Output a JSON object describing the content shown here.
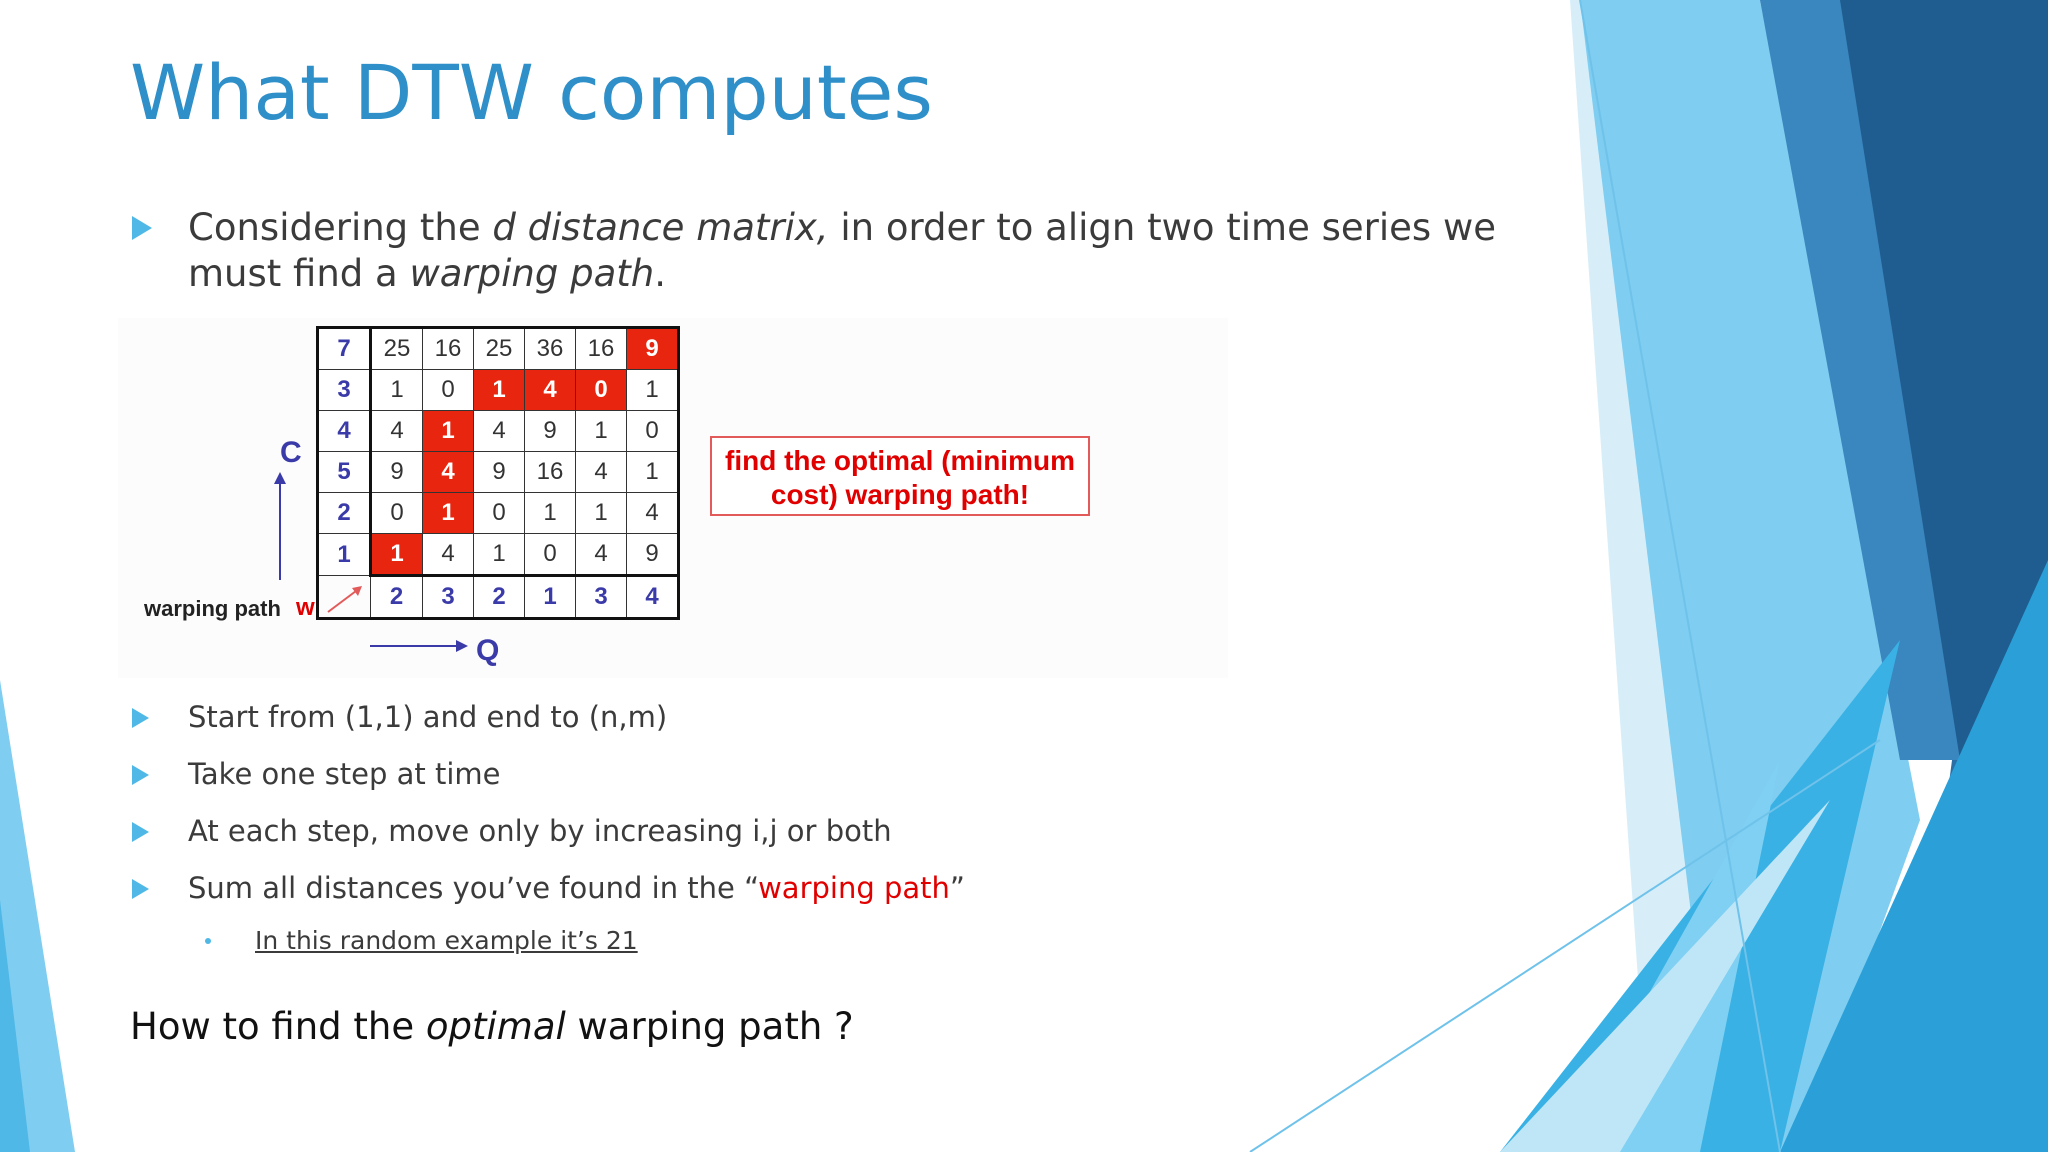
{
  "slide": {
    "title": "What DTW computes",
    "intro": {
      "part1": "Considering the ",
      "italic1": "d distance matrix,",
      "part2": " in order to align two time series we must find a ",
      "italic2": "warping path",
      "part3": "."
    },
    "figure": {
      "c_label": "C",
      "q_label": "Q",
      "warping_label": "warping path",
      "w_label": "w",
      "callout": "find the optimal (minimum cost) warping path!",
      "row_labels": [
        "7",
        "3",
        "4",
        "5",
        "2",
        "1"
      ],
      "col_labels": [
        "2",
        "3",
        "2",
        "1",
        "3",
        "4"
      ],
      "rows": [
        [
          "25",
          "16",
          "25",
          "36",
          "16",
          "9"
        ],
        [
          "1",
          "0",
          "1",
          "4",
          "0",
          "1"
        ],
        [
          "4",
          "1",
          "4",
          "9",
          "1",
          "0"
        ],
        [
          "9",
          "4",
          "9",
          "16",
          "4",
          "1"
        ],
        [
          "0",
          "1",
          "0",
          "1",
          "1",
          "4"
        ],
        [
          "1",
          "4",
          "1",
          "0",
          "4",
          "9"
        ]
      ],
      "path_cells": [
        [
          0,
          5
        ],
        [
          1,
          2
        ],
        [
          1,
          3
        ],
        [
          1,
          4
        ],
        [
          2,
          1
        ],
        [
          3,
          1
        ],
        [
          4,
          1
        ],
        [
          5,
          0
        ]
      ]
    },
    "bullets": [
      {
        "text": "Start from (1,1) and end to (n,m)"
      },
      {
        "text": "Take one step at time"
      },
      {
        "text": "At each step, move only by increasing i,j or both"
      },
      {
        "text_before": "Sum all distances you’ve found in the “",
        "highlight": "warping path",
        "text_after": "”"
      }
    ],
    "sub_bullet": "In this random example it’s 21",
    "question": {
      "before": "How to find the ",
      "italic": "optimal",
      "after": " warping path ?"
    },
    "colors": {
      "title": "#2f8fc9",
      "bullet": "#4fb8e6",
      "path_cell": "#e8250f",
      "highlight": "#e00000"
    }
  }
}
